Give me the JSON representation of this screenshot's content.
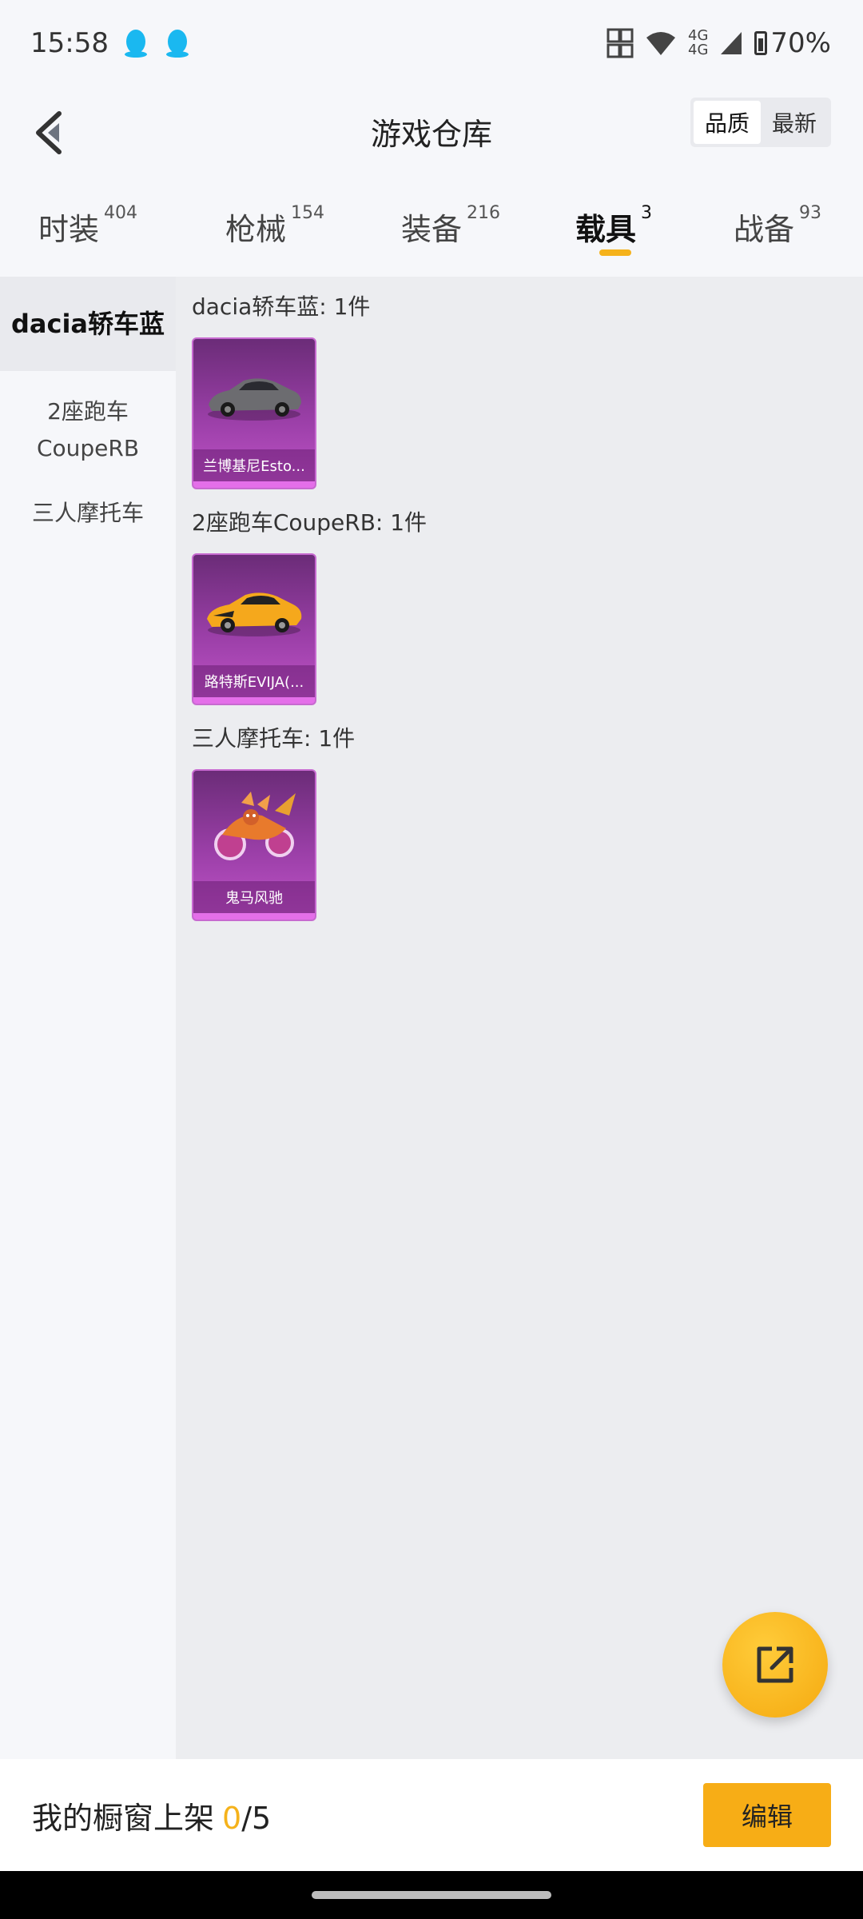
{
  "status_bar": {
    "time": "15:58",
    "battery": "70%",
    "network": "4G"
  },
  "header": {
    "title": "游戏仓库",
    "sort_options": [
      "品质",
      "最新"
    ],
    "sort_active": "品质"
  },
  "tabs": [
    {
      "label": "时装",
      "count": "404"
    },
    {
      "label": "枪械",
      "count": "154"
    },
    {
      "label": "装备",
      "count": "216"
    },
    {
      "label": "载具",
      "count": "3",
      "active": true
    },
    {
      "label": "战备",
      "count": "93"
    }
  ],
  "sidebar": {
    "items": [
      {
        "label": "dacia轿车蓝",
        "active": true
      },
      {
        "label": "2座跑车\nCoupeRB"
      },
      {
        "label": "三人摩托车"
      }
    ]
  },
  "groups": [
    {
      "title": "dacia轿车蓝: 1件",
      "items": [
        {
          "name": "兰博基尼Esto..."
        }
      ]
    },
    {
      "title": "2座跑车CoupeRB: 1件",
      "items": [
        {
          "name": "路特斯EVIJA(..."
        }
      ]
    },
    {
      "title": "三人摩托车: 1件",
      "items": [
        {
          "name": "鬼马风驰"
        }
      ]
    }
  ],
  "bottom": {
    "showcase_label": "我的橱窗上架",
    "showcase_count": "0",
    "showcase_total": "/5",
    "edit_label": "编辑"
  },
  "colors": {
    "accent": "#f5b21b",
    "card_purple": "#9b3fa8"
  }
}
